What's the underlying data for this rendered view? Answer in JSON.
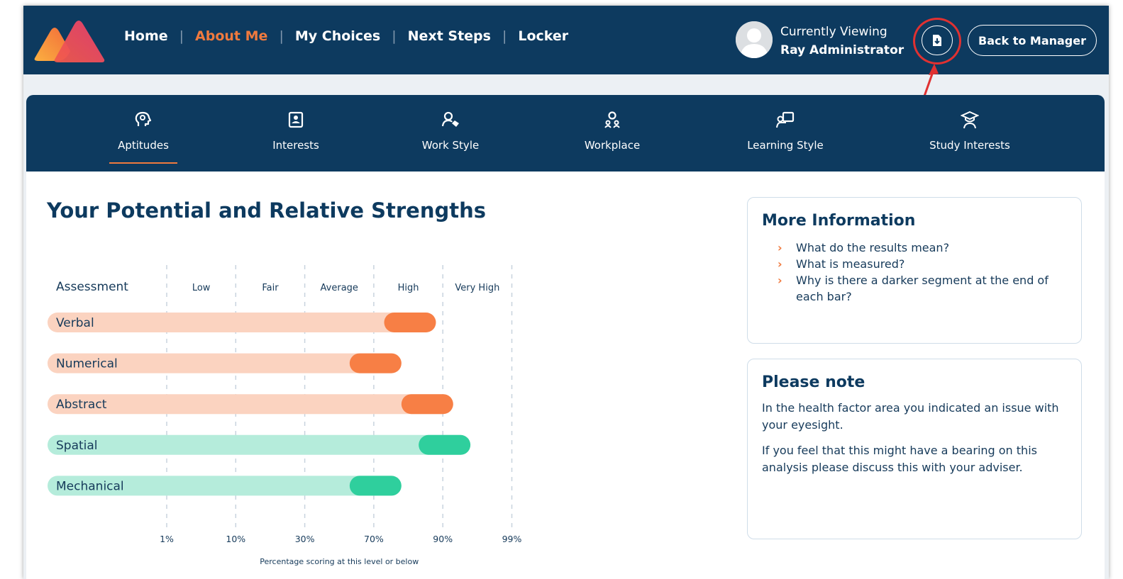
{
  "nav": {
    "items": [
      {
        "label": "Home",
        "active": false
      },
      {
        "label": "About Me",
        "active": true
      },
      {
        "label": "My Choices",
        "active": false
      },
      {
        "label": "Next Steps",
        "active": false
      },
      {
        "label": "Locker",
        "active": false
      }
    ],
    "separator": "|"
  },
  "header": {
    "viewing_label": "Currently Viewing",
    "viewing_name": "Ray Administrator",
    "back_button": "Back to Manager",
    "download_icon": "download-file-icon"
  },
  "tabs": [
    {
      "label": "Aptitudes",
      "icon": "head-gear-icon",
      "active": true
    },
    {
      "label": "Interests",
      "icon": "id-card-icon",
      "active": false
    },
    {
      "label": "Work Style",
      "icon": "user-tag-icon",
      "active": false
    },
    {
      "label": "Workplace",
      "icon": "team-icon",
      "active": false
    },
    {
      "label": "Learning Style",
      "icon": "teacher-board-icon",
      "active": false
    },
    {
      "label": "Study Interests",
      "icon": "graduate-icon",
      "active": false
    }
  ],
  "page": {
    "title": "Your Potential and Relative Strengths"
  },
  "more_info": {
    "title": "More Information",
    "items": [
      "What do the results mean?",
      "What is measured?",
      "Why is there a darker segment at the end of each bar?"
    ]
  },
  "note": {
    "title": "Please note",
    "paragraphs": [
      "In the health factor area you indicated an issue with your eyesight.",
      "If you feel that this might have a bearing on this analysis please discuss this with your adviser."
    ]
  },
  "chart_data": {
    "type": "bar",
    "orientation": "horizontal",
    "row_header": "Assessment",
    "level_labels": [
      "Low",
      "Fair",
      "Average",
      "High",
      "Very High"
    ],
    "tick_labels": [
      "1%",
      "10%",
      "30%",
      "70%",
      "90%",
      "99%"
    ],
    "xlabel": "Percentage scoring at this level or below",
    "categories": [
      "Verbal",
      "Numerical",
      "Abstract",
      "Spatial",
      "Mechanical"
    ],
    "colors": {
      "orange_light": "#fbd3c0",
      "orange_dark": "#f77f45",
      "green_light": "#b5ecdb",
      "green_dark": "#2fcf9d",
      "grid": "#c8d3de"
    },
    "bars": [
      {
        "name": "Verbal",
        "range_start": 3.15,
        "range_end": 3.9,
        "palette": "orange"
      },
      {
        "name": "Numerical",
        "range_start": 2.65,
        "range_end": 3.4,
        "palette": "orange"
      },
      {
        "name": "Abstract",
        "range_start": 3.4,
        "range_end": 4.15,
        "palette": "orange"
      },
      {
        "name": "Spatial",
        "range_start": 3.65,
        "range_end": 4.4,
        "palette": "green"
      },
      {
        "name": "Mechanical",
        "range_start": 2.65,
        "range_end": 3.4,
        "palette": "green"
      }
    ],
    "grid": true
  }
}
